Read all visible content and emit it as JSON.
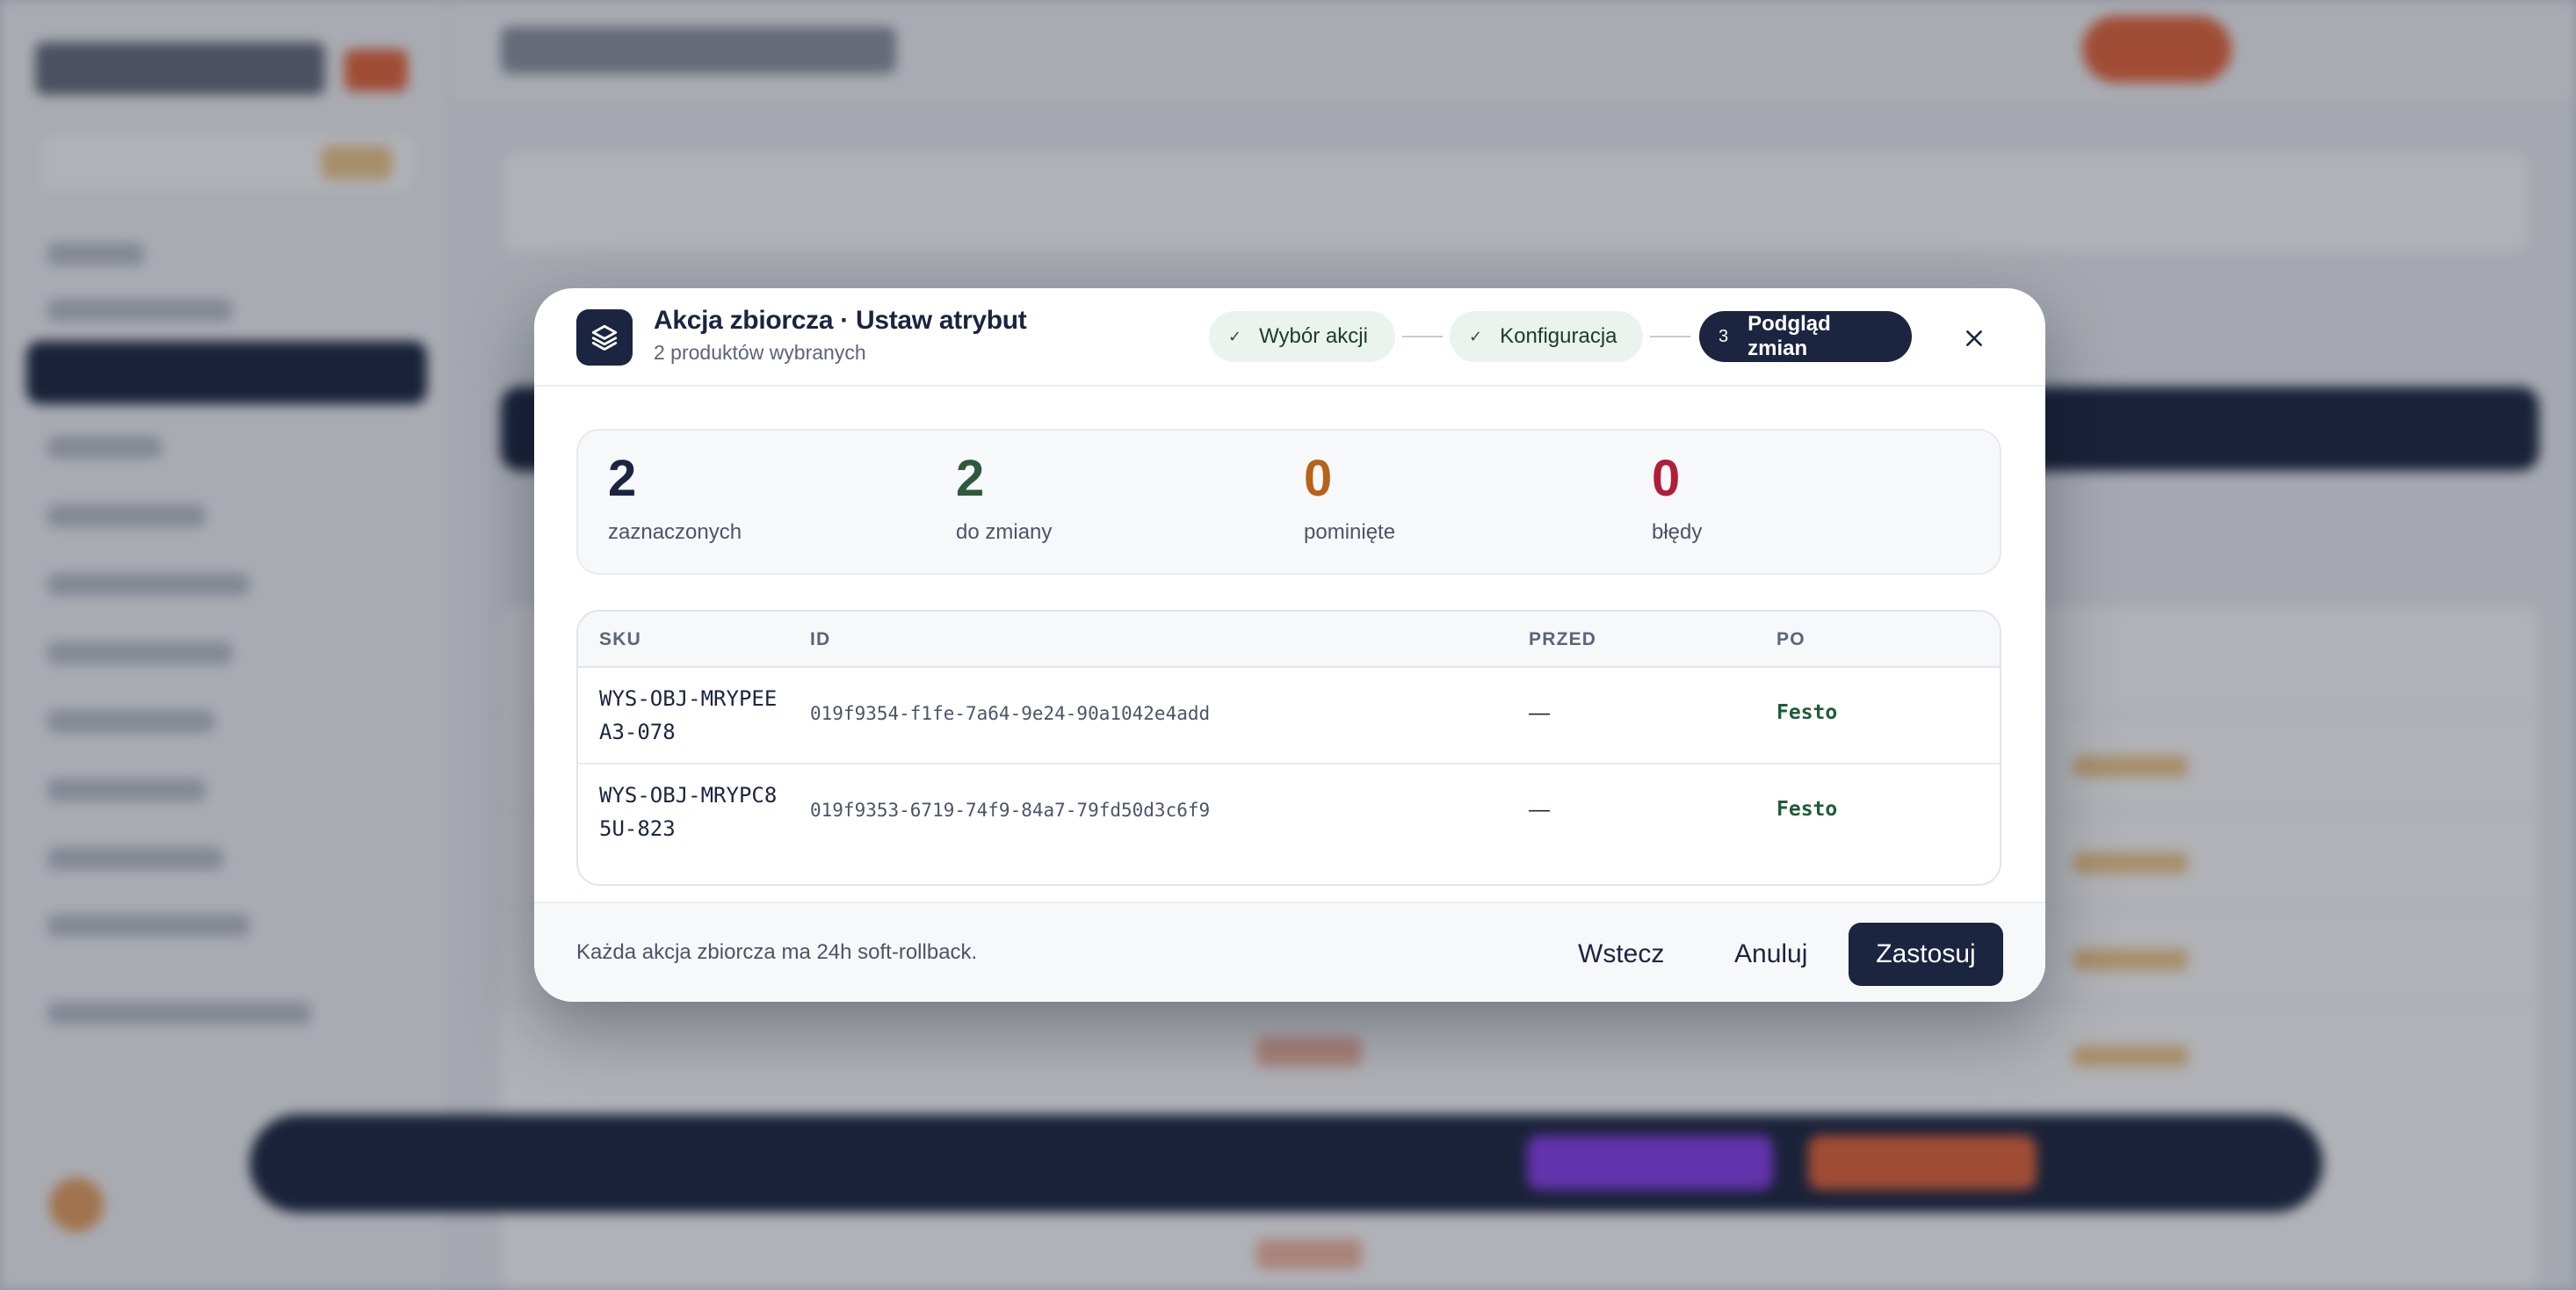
{
  "modal": {
    "title": "Akcja zbiorcza · Ustaw atrybut",
    "subtitle": "2 produktów wybranych",
    "icon": "layers-icon",
    "steps": [
      {
        "label": "Wybór akcji",
        "state": "done",
        "marker": "✓"
      },
      {
        "label": "Konfiguracja",
        "state": "done",
        "marker": "✓"
      },
      {
        "label": "Podgląd zmian",
        "state": "active",
        "marker": "3"
      }
    ],
    "close_icon": "close-icon"
  },
  "stats": [
    {
      "value": "2",
      "label": "zaznaczonych",
      "color": "#1b2540"
    },
    {
      "value": "2",
      "label": "do zmiany",
      "color": "#2d5a3d"
    },
    {
      "value": "0",
      "label": "pominięte",
      "color": "#b8621a"
    },
    {
      "value": "0",
      "label": "błędy",
      "color": "#b01e3a"
    }
  ],
  "table": {
    "columns": [
      "SKU",
      "ID",
      "PRZED",
      "PO"
    ],
    "rows": [
      {
        "sku": "WYS-OBJ-MRYPEEA3-078",
        "id": "019f9354-f1fe-7a64-9e24-90a1042e4add",
        "before": "—",
        "after": "Festo"
      },
      {
        "sku": "WYS-OBJ-MRYPC85U-823",
        "id": "019f9353-6719-74f9-84a7-79fd50d3c6f9",
        "before": "—",
        "after": "Festo"
      }
    ]
  },
  "footer": {
    "note": "Każda akcja zbiorcza ma 24h soft-rollback.",
    "back_label": "Wstecz",
    "cancel_label": "Anuluj",
    "apply_label": "Zastosuj"
  },
  "colors": {
    "primary": "#1b2540",
    "accent": "#e8663a",
    "success": "#1f5c3a"
  }
}
